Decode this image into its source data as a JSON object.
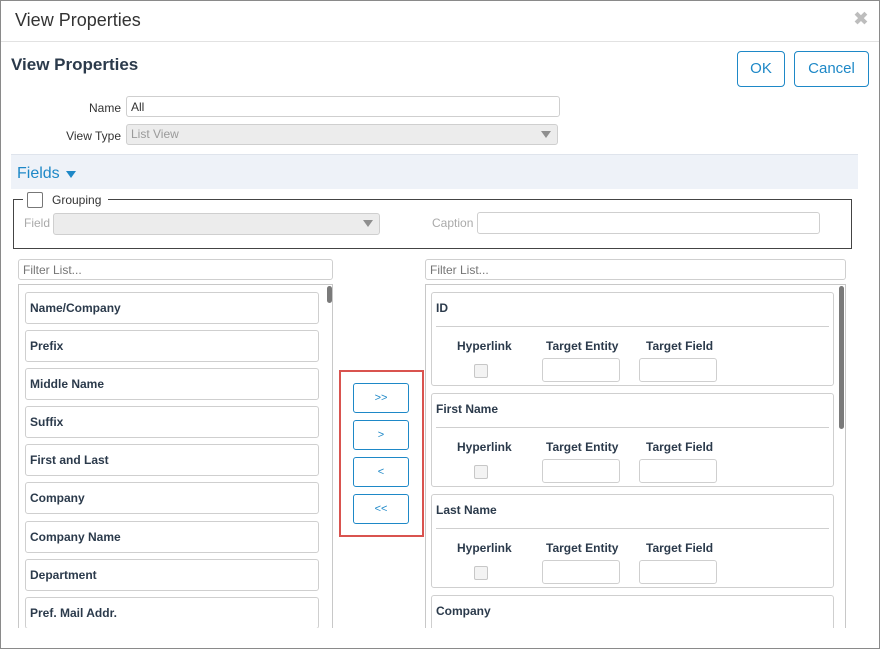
{
  "window": {
    "title": "View Properties"
  },
  "header": {
    "heading": "View Properties",
    "ok_label": "OK",
    "cancel_label": "Cancel"
  },
  "form": {
    "name_label": "Name",
    "name_value": "All",
    "view_type_label": "View Type",
    "view_type_value": "List View"
  },
  "fields_section": {
    "label": "Fields"
  },
  "grouping": {
    "label": "Grouping",
    "field_label": "Field",
    "caption_label": "Caption"
  },
  "available": {
    "filter_placeholder": "Filter List...",
    "items": [
      "Name/Company",
      "Prefix",
      "Middle Name",
      "Suffix",
      "First and Last",
      "Company",
      "Company Name",
      "Department",
      "Pref. Mail Addr."
    ]
  },
  "move_buttons": {
    "add_all": ">>",
    "add": ">",
    "remove": "<",
    "remove_all": "<<"
  },
  "selected": {
    "filter_placeholder": "Filter List...",
    "col_hyperlink": "Hyperlink",
    "col_target_entity": "Target Entity",
    "col_target_field": "Target Field",
    "items": [
      "ID",
      "First Name",
      "Last Name",
      "Company"
    ]
  },
  "colors": {
    "accent": "#1e88c7",
    "highlight_border": "#d9534f",
    "section_bg": "#eef2f8"
  },
  "icons": {
    "close": "close-icon",
    "dropdown": "chevron-down-icon",
    "caret": "caret-down-icon"
  }
}
